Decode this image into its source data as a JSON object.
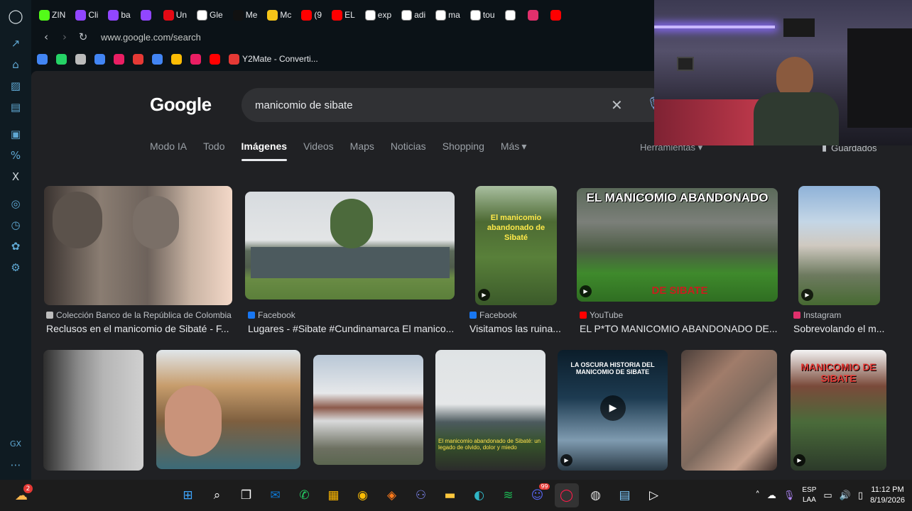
{
  "browser": {
    "tabs": [
      {
        "label": "ZIN",
        "icon": "kick-icon",
        "color": "#53fc18"
      },
      {
        "label": "Cli",
        "icon": "twitch-icon",
        "color": "#9146ff"
      },
      {
        "label": "ba",
        "icon": "twitch-icon",
        "color": "#9146ff"
      },
      {
        "label": "",
        "icon": "twitch-icon",
        "color": "#9146ff"
      },
      {
        "label": "Un",
        "icon": "netflix-icon",
        "color": "#e50914"
      },
      {
        "label": "Gle",
        "icon": "globe-icon",
        "color": "#ffffff"
      },
      {
        "label": "Me",
        "icon": "tiktok-icon",
        "color": "#111111"
      },
      {
        "label": "Mc",
        "icon": "smiley-icon",
        "color": "#f5c518"
      },
      {
        "label": "(9",
        "icon": "youtube-icon",
        "color": "#ff0000"
      },
      {
        "label": "EL",
        "icon": "youtube-icon",
        "color": "#ff0000"
      },
      {
        "label": "exp",
        "icon": "google-icon",
        "color": "#ffffff"
      },
      {
        "label": "adi",
        "icon": "google-icon",
        "color": "#ffffff"
      },
      {
        "label": "ma",
        "icon": "google-icon",
        "color": "#ffffff"
      },
      {
        "label": "tou",
        "icon": "google-icon",
        "color": "#ffffff"
      },
      {
        "label": "",
        "icon": "google-icon",
        "color": "#ffffff"
      },
      {
        "label": "",
        "icon": "instagram-icon",
        "color": "#e1306c"
      },
      {
        "label": "",
        "icon": "youtube-icon",
        "color": "#ff0000"
      }
    ],
    "url": "www.google.com/search",
    "bookmarks": [
      {
        "label": "",
        "icon": "docs-icon",
        "color": "#4285f4"
      },
      {
        "label": "",
        "icon": "whatsapp-icon",
        "color": "#25d366"
      },
      {
        "label": "",
        "icon": "app-icon",
        "color": "#bbbbbb"
      },
      {
        "label": "",
        "icon": "translate-icon",
        "color": "#4285f4"
      },
      {
        "label": "",
        "icon": "cross-icon",
        "color": "#e91e63"
      },
      {
        "label": "",
        "icon": "flag-icon",
        "color": "#e53935"
      },
      {
        "label": "",
        "icon": "triangle-icon",
        "color": "#4285f4"
      },
      {
        "label": "",
        "icon": "stack-icon",
        "color": "#fbbc04"
      },
      {
        "label": "",
        "icon": "circle-icon",
        "color": "#e91e63"
      },
      {
        "label": "",
        "icon": "youtube-icon",
        "color": "#ff0000"
      },
      {
        "label": "Y2Mate - Converti...",
        "icon": "y2mate-icon",
        "color": "#e53935"
      }
    ]
  },
  "google": {
    "logo": "Google",
    "query": "manicomio de sibate",
    "filters": [
      "Modo IA",
      "Todo",
      "Imágenes",
      "Videos",
      "Maps",
      "Noticias",
      "Shopping",
      "Más"
    ],
    "active_filter": "Imágenes",
    "tools": "Herramientas",
    "saved": "Guardados"
  },
  "results_row1": [
    {
      "source": "Colección Banco de la República de Colombia",
      "caption": "Reclusos en el manicomio de Sibaté - F...",
      "source_color": "#bdbdbd"
    },
    {
      "source": "Facebook",
      "caption": "Lugares - #Sibate #Cundinamarca El manico...",
      "source_color": "#1877f2"
    },
    {
      "source": "Facebook",
      "caption": "Visitamos las ruina...",
      "source_color": "#1877f2",
      "overlay": "El manicomio abandonado de Sibaté"
    },
    {
      "source": "YouTube",
      "caption": "EL P*TO MANICOMIO ABANDONADO DE...",
      "source_color": "#ff0000",
      "overlay": "EL MANICOMIO ABANDONADO",
      "overlay2": "DE SIBATE"
    },
    {
      "source": "Instagram",
      "caption": "Sobrevolando el m...",
      "source_color": "#e1306c"
    }
  ],
  "results_row2": [
    {
      "overlay": ""
    },
    {
      "overlay": ""
    },
    {
      "overlay": ""
    },
    {
      "overlay": "El manicomio abandonado de Sibaté: un legado de olvido, dolor y miedo"
    },
    {
      "overlay": "LA OSCURA HISTORIA DEL MANICOMIO DE SIBATE"
    },
    {
      "overlay": ""
    },
    {
      "overlay": "MANICOMIO DE SIBATE"
    }
  ],
  "taskbar": {
    "language": "ESP",
    "layout": "LAA",
    "time": "11:12 PM",
    "date": "8/19/2026",
    "notification_badge": "2",
    "discord_badge": "99"
  }
}
